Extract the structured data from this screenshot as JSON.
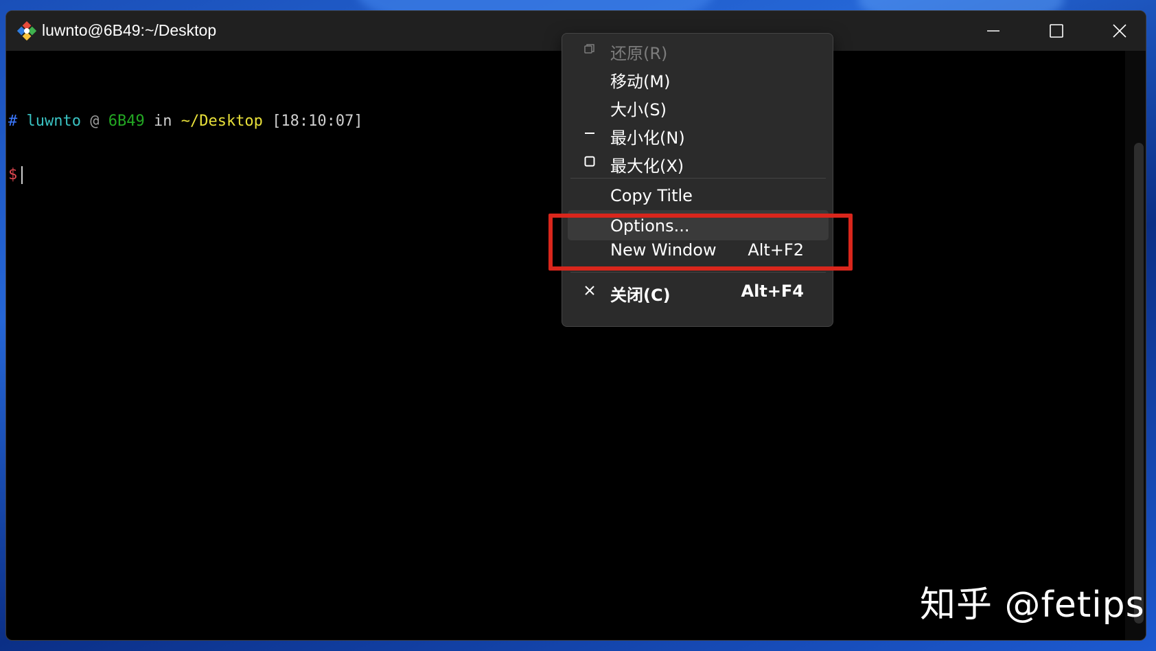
{
  "window": {
    "title": "luwnto@6B49:~/Desktop",
    "controls": {
      "minimize": "minimize",
      "maximize": "maximize",
      "close": "close"
    }
  },
  "terminal": {
    "prompt": {
      "hash": "#",
      "user": "luwnto",
      "at": "@",
      "host": "6B49",
      "in": "in",
      "dir": "~/Desktop",
      "time": "[18:10:07]"
    },
    "input_prompt": "$"
  },
  "context_menu": {
    "items": [
      {
        "label": "还原(R)",
        "icon": "restore-icon",
        "disabled": true
      },
      {
        "label": "移动(M)"
      },
      {
        "label": "大小(S)"
      },
      {
        "label": "最小化(N)",
        "icon": "minimize-icon"
      },
      {
        "label": "最大化(X)",
        "icon": "maximize-icon"
      },
      {
        "label": "Copy Title"
      },
      {
        "label": "Options..."
      },
      {
        "label": "New Window",
        "shortcut": "Alt+F2"
      },
      {
        "label": "关闭(C)",
        "icon": "close-icon",
        "shortcut": "Alt+F4"
      }
    ]
  },
  "watermark": "知乎 @fetips",
  "colors": {
    "highlight_box": "#d9261c",
    "menu_bg": "#2b2b2b",
    "terminal_bg": "#000000"
  }
}
